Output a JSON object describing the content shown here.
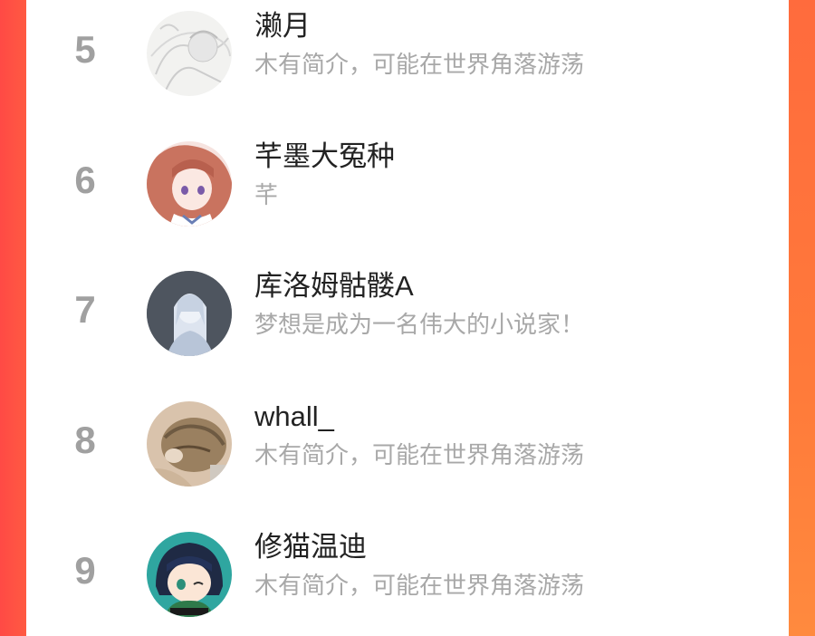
{
  "ranking": {
    "rows": [
      {
        "rank": "5",
        "name": "濑月",
        "bio": "木有简介，可能在世界角落游荡",
        "avatar_icon": "anime-sketch-avatar-icon"
      },
      {
        "rank": "6",
        "name": "芊墨大冤种",
        "bio": "芊",
        "avatar_icon": "anime-girl-avatar-icon"
      },
      {
        "rank": "7",
        "name": "库洛姆骷髅A",
        "bio": "梦想是成为一名伟大的小说家！",
        "avatar_icon": "anime-boy-avatar-icon"
      },
      {
        "rank": "8",
        "name": "whall_",
        "bio": "木有简介，可能在世界角落游荡",
        "avatar_icon": "cat-photo-avatar-icon"
      },
      {
        "rank": "9",
        "name": "修猫温迪",
        "bio": "木有简介，可能在世界角落游荡",
        "avatar_icon": "chibi-character-avatar-icon"
      }
    ]
  },
  "colors": {
    "background": "#ff5a42",
    "card": "#ffffff",
    "rank": "#a0a0a0",
    "name": "#222222",
    "bio": "#a8a8a8"
  }
}
